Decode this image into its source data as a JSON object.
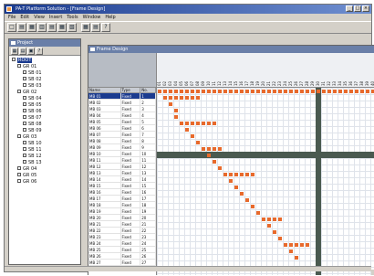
{
  "app": {
    "title": "PA-T Platform Solution - [Frame Design]",
    "window_buttons": [
      "_",
      "□",
      "×"
    ]
  },
  "menu": [
    "File",
    "Edit",
    "View",
    "Insert",
    "Tools",
    "Window",
    "Help"
  ],
  "toolbar": [
    "□",
    "▤",
    "▦",
    "▥",
    "▤",
    "▦",
    "▧",
    "|",
    "▦",
    "▤",
    "?"
  ],
  "tree": {
    "caption": "Project",
    "tools": [
      "▦",
      "▤",
      "▣",
      "?"
    ],
    "rows": [
      {
        "label": "ROOT",
        "indent": 0,
        "selected": true
      },
      {
        "label": "GR 01",
        "indent": 1
      },
      {
        "label": "SB 01",
        "indent": 2
      },
      {
        "label": "SB 02",
        "indent": 2
      },
      {
        "label": "SB 03",
        "indent": 2
      },
      {
        "label": "GR 02",
        "indent": 1
      },
      {
        "label": "SB 04",
        "indent": 2
      },
      {
        "label": "SB 05",
        "indent": 2
      },
      {
        "label": "SB 06",
        "indent": 2
      },
      {
        "label": "SB 07",
        "indent": 2
      },
      {
        "label": "SB 08",
        "indent": 2
      },
      {
        "label": "SB 09",
        "indent": 2
      },
      {
        "label": "GR 03",
        "indent": 1
      },
      {
        "label": "SB 10",
        "indent": 2
      },
      {
        "label": "SB 11",
        "indent": 2
      },
      {
        "label": "SB 12",
        "indent": 2
      },
      {
        "label": "SB 13",
        "indent": 2
      },
      {
        "label": "GR 04",
        "indent": 1
      },
      {
        "label": "GR 05",
        "indent": 1
      },
      {
        "label": "GR 06",
        "indent": 1
      }
    ]
  },
  "document": {
    "caption": "Frame Design",
    "column_labels": [
      "01",
      "02",
      "03",
      "04",
      "05",
      "06",
      "07",
      "08",
      "09",
      "10",
      "11",
      "12",
      "13",
      "14",
      "15",
      "16",
      "17",
      "18",
      "19",
      "20",
      "21",
      "22",
      "23",
      "24",
      "25",
      "26",
      "27",
      "28",
      "29",
      "30",
      "31",
      "32",
      "33",
      "34",
      "35",
      "36",
      "37",
      "38",
      "39",
      "40"
    ],
    "left_headers": [
      "Name",
      "Type",
      "No."
    ],
    "rows": [
      {
        "name": "MB 01",
        "type": "Fixed",
        "num": "1",
        "selected": true
      },
      {
        "name": "MB 02",
        "type": "Fixed",
        "num": "2"
      },
      {
        "name": "MB 03",
        "type": "Fixed",
        "num": "3"
      },
      {
        "name": "MB 04",
        "type": "Fixed",
        "num": "4"
      },
      {
        "name": "MB 05",
        "type": "Fixed",
        "num": "5"
      },
      {
        "name": "MB 06",
        "type": "Fixed",
        "num": "6"
      },
      {
        "name": "MB 07",
        "type": "Fixed",
        "num": "7"
      },
      {
        "name": "MB 08",
        "type": "Fixed",
        "num": "8"
      },
      {
        "name": "MB 09",
        "type": "Fixed",
        "num": "9"
      },
      {
        "name": "MB 10",
        "type": "Fixed",
        "num": "10"
      },
      {
        "name": "MB 11",
        "type": "Fixed",
        "num": "11"
      },
      {
        "name": "MB 12",
        "type": "Fixed",
        "num": "12"
      },
      {
        "name": "MB 13",
        "type": "Fixed",
        "num": "13"
      },
      {
        "name": "MB 14",
        "type": "Fixed",
        "num": "14"
      },
      {
        "name": "MB 15",
        "type": "Fixed",
        "num": "15"
      },
      {
        "name": "MB 16",
        "type": "Fixed",
        "num": "16"
      },
      {
        "name": "MB 17",
        "type": "Fixed",
        "num": "17"
      },
      {
        "name": "MB 18",
        "type": "Fixed",
        "num": "18"
      },
      {
        "name": "MB 19",
        "type": "Fixed",
        "num": "19"
      },
      {
        "name": "MB 20",
        "type": "Fixed",
        "num": "20"
      },
      {
        "name": "MB 21",
        "type": "Fixed",
        "num": "21"
      },
      {
        "name": "MB 22",
        "type": "Fixed",
        "num": "22"
      },
      {
        "name": "MB 23",
        "type": "Fixed",
        "num": "23"
      },
      {
        "name": "MB 24",
        "type": "Fixed",
        "num": "24"
      },
      {
        "name": "MB 25",
        "type": "Fixed",
        "num": "25"
      },
      {
        "name": "MB 26",
        "type": "Fixed",
        "num": "26"
      },
      {
        "name": "MB 27",
        "type": "Fixed",
        "num": "27"
      }
    ],
    "marks": [
      [
        0,
        0
      ],
      [
        1,
        0
      ],
      [
        2,
        0
      ],
      [
        3,
        0
      ],
      [
        4,
        0
      ],
      [
        5,
        0
      ],
      [
        6,
        0
      ],
      [
        7,
        0
      ],
      [
        8,
        0
      ],
      [
        9,
        0
      ],
      [
        10,
        0
      ],
      [
        11,
        0
      ],
      [
        12,
        0
      ],
      [
        13,
        0
      ],
      [
        14,
        0
      ],
      [
        15,
        0
      ],
      [
        16,
        0
      ],
      [
        17,
        0
      ],
      [
        18,
        0
      ],
      [
        19,
        0
      ],
      [
        20,
        0
      ],
      [
        21,
        0
      ],
      [
        22,
        0
      ],
      [
        23,
        0
      ],
      [
        24,
        0
      ],
      [
        25,
        0
      ],
      [
        26,
        0
      ],
      [
        27,
        0
      ],
      [
        28,
        0
      ],
      [
        29,
        0
      ],
      [
        30,
        0
      ],
      [
        31,
        0
      ],
      [
        32,
        0
      ],
      [
        33,
        0
      ],
      [
        34,
        0
      ],
      [
        35,
        0
      ],
      [
        36,
        0
      ],
      [
        37,
        0
      ],
      [
        38,
        0
      ],
      [
        39,
        0
      ],
      [
        1,
        1
      ],
      [
        2,
        1
      ],
      [
        3,
        1
      ],
      [
        4,
        1
      ],
      [
        5,
        1
      ],
      [
        6,
        1
      ],
      [
        7,
        1
      ],
      [
        2,
        2
      ],
      [
        3,
        3
      ],
      [
        3,
        4
      ],
      [
        4,
        5
      ],
      [
        5,
        5
      ],
      [
        6,
        5
      ],
      [
        7,
        5
      ],
      [
        8,
        5
      ],
      [
        9,
        5
      ],
      [
        10,
        5
      ],
      [
        5,
        6
      ],
      [
        6,
        7
      ],
      [
        7,
        8
      ],
      [
        8,
        9
      ],
      [
        9,
        9
      ],
      [
        10,
        9
      ],
      [
        11,
        9
      ],
      [
        9,
        10
      ],
      [
        10,
        11
      ],
      [
        11,
        12
      ],
      [
        12,
        13
      ],
      [
        13,
        13
      ],
      [
        14,
        13
      ],
      [
        15,
        13
      ],
      [
        16,
        13
      ],
      [
        17,
        13
      ],
      [
        13,
        14
      ],
      [
        14,
        15
      ],
      [
        15,
        16
      ],
      [
        16,
        17
      ],
      [
        17,
        18
      ],
      [
        18,
        19
      ],
      [
        19,
        20
      ],
      [
        20,
        20
      ],
      [
        21,
        20
      ],
      [
        22,
        20
      ],
      [
        20,
        21
      ],
      [
        21,
        22
      ],
      [
        22,
        23
      ],
      [
        23,
        24
      ],
      [
        24,
        24
      ],
      [
        25,
        24
      ],
      [
        26,
        24
      ],
      [
        27,
        24
      ],
      [
        24,
        25
      ],
      [
        25,
        26
      ]
    ],
    "band_col": 29,
    "band_row": 10
  },
  "colors": {
    "mark": "#e86a2c",
    "band": "#4a5a50",
    "selection": "#1b3b8f",
    "caption": "#6a7fa8"
  }
}
